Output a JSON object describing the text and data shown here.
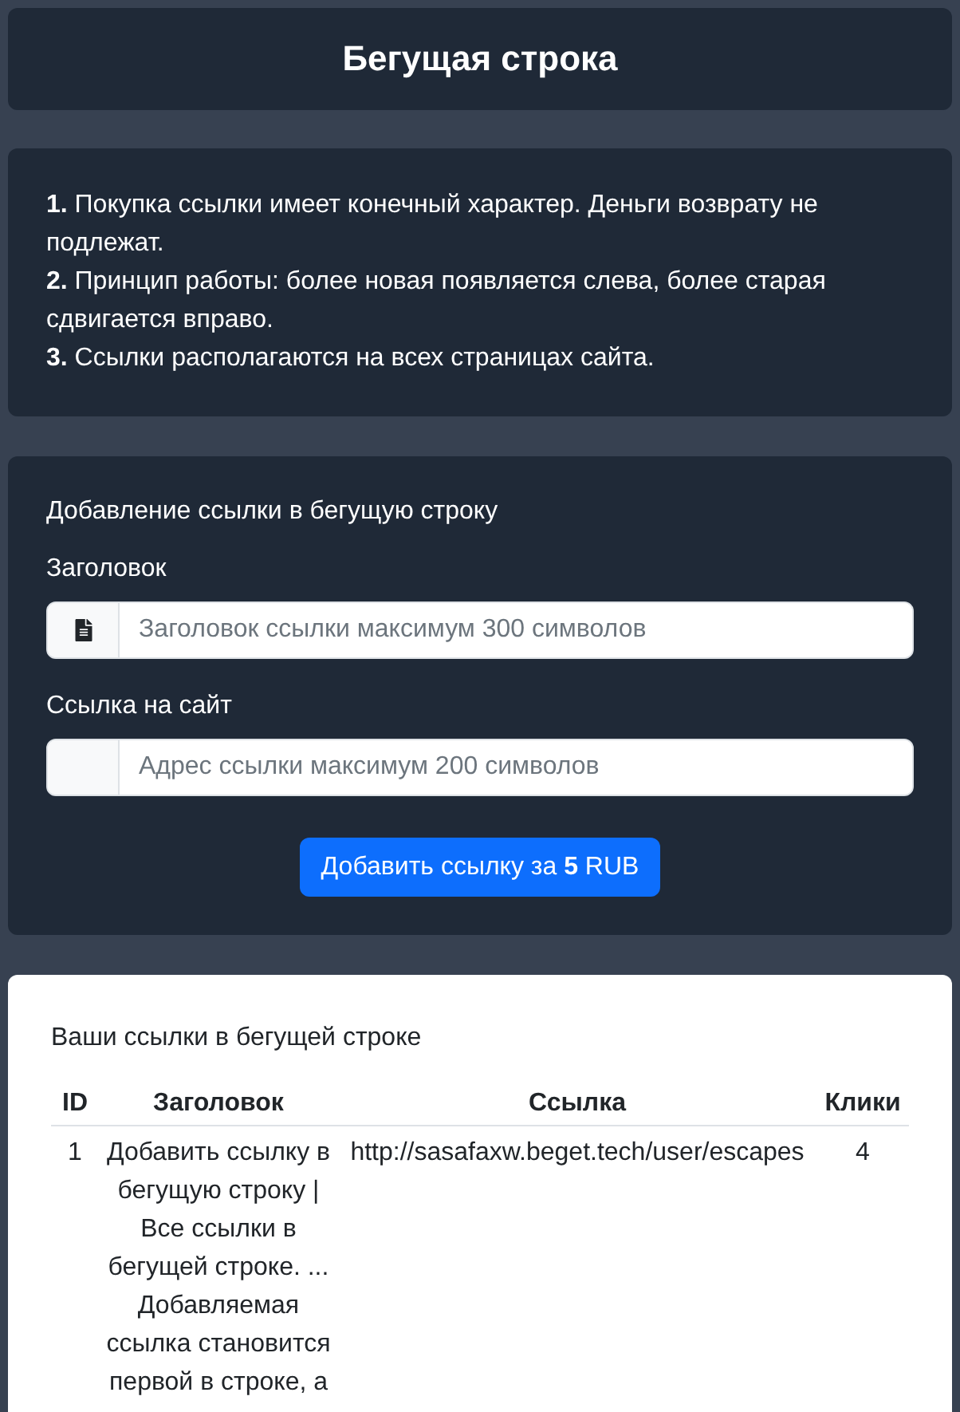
{
  "header": {
    "title": "Бегущая строка"
  },
  "rules": [
    "**1.** Покупка ссылки имеет конечный характер. Деньги возврату не подлежат.",
    "**2.** Принцип работы: более новая появляется слева, более старая сдвигается вправо.",
    "**3.** Ссылки располагаются на всех страницах сайта."
  ],
  "form": {
    "title": "Добавление ссылки в бегущую строку",
    "fields": [
      {
        "label": "Заголовок",
        "placeholder": "Заголовок ссылки максимум 300 символов",
        "kind": "icon"
      },
      {
        "label": "Ссылка на сайт",
        "placeholder": "Адрес ссылки максимум 200 символов",
        "kind": "blank"
      }
    ],
    "submit": "Добавить ссылку за **5** RUB"
  },
  "links": {
    "title": "Ваши ссылки в бегущей строке",
    "columns": [
      "ID",
      "Заголовок",
      "Ссылка",
      "Клики"
    ],
    "rows": [
      {
        "id": "1",
        "title": "Добавить ссылку в бегущую строку | Все ссылки в бегущей строке. ... Добавляемая ссылка становится первой в строке, а",
        "link": "http://sasafaxw.beget.tech/user/escapes",
        "clicks": "4"
      }
    ]
  }
}
